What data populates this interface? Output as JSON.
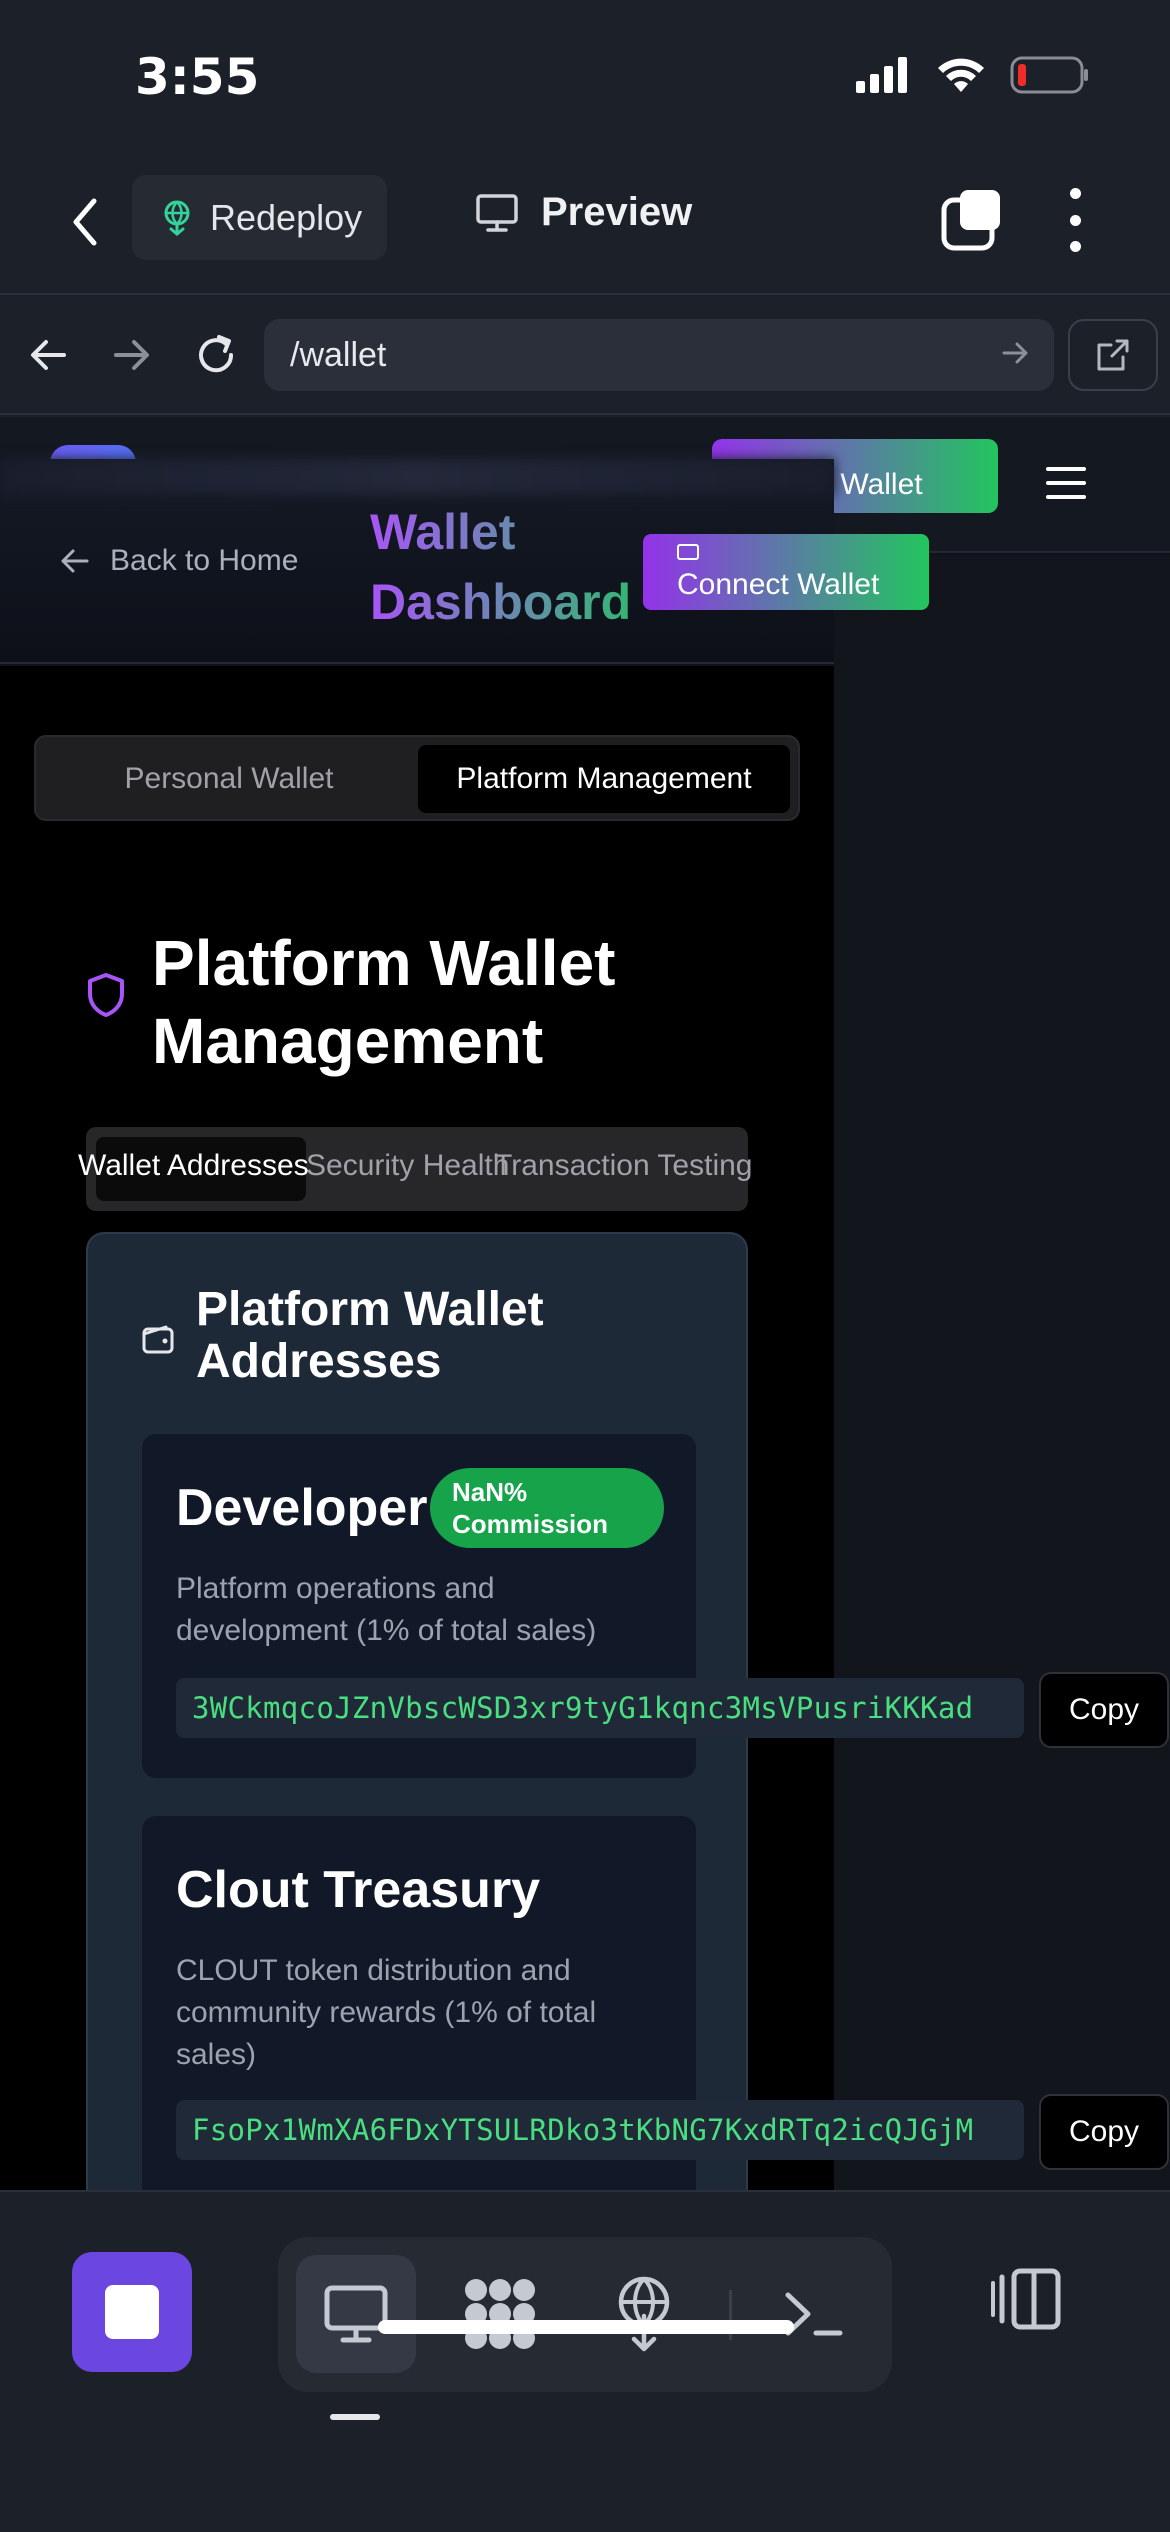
{
  "status_bar": {
    "time": "3:55",
    "icons": [
      "signal-icon",
      "wifi-icon",
      "battery-low-icon"
    ]
  },
  "app_bar": {
    "redeploy_label": "Redeploy",
    "preview_label": "Preview"
  },
  "browser": {
    "url": "/wallet"
  },
  "site_header": {
    "connect_wallet_label": "ect Wallet",
    "back_home_label": "Back to Home",
    "title": "Wallet Dashboard",
    "connect_wallet_main_label": "Connect Wallet"
  },
  "mode_tabs": [
    {
      "label": "Personal Wallet",
      "active": false
    },
    {
      "label": "Platform Management",
      "active": true
    }
  ],
  "platform": {
    "title": "Platform Wallet Management",
    "sub_tabs": [
      {
        "label": "Wallet Addresses",
        "active": true
      },
      {
        "label": "Security Health",
        "active": false
      },
      {
        "label": "Transaction Testing",
        "active": false
      }
    ],
    "card_title": "Platform Wallet Addresses",
    "wallets": [
      {
        "name": "Developer",
        "badge": "NaN% Commission",
        "description": "Platform operations and development (1% of total sales)",
        "address": "3WCkmqcoJZnVbscWSD3xr9tyG1kqnc3MsVPusriKKKad",
        "copy_label": "Copy"
      },
      {
        "name": "Clout Treasury",
        "description": "CLOUT token distribution and community rewards (1% of total sales)",
        "address": "FsoPx1WmXA6FDxYTSULRDko3tKbNG7KxdRTq2icQJGjM",
        "copy_label": "Copy"
      }
    ]
  },
  "colors": {
    "accent_purple": "#a855f7",
    "accent_green": "#22c55e",
    "badge_green": "#16a34a",
    "stop_button": "#6b46e0"
  }
}
